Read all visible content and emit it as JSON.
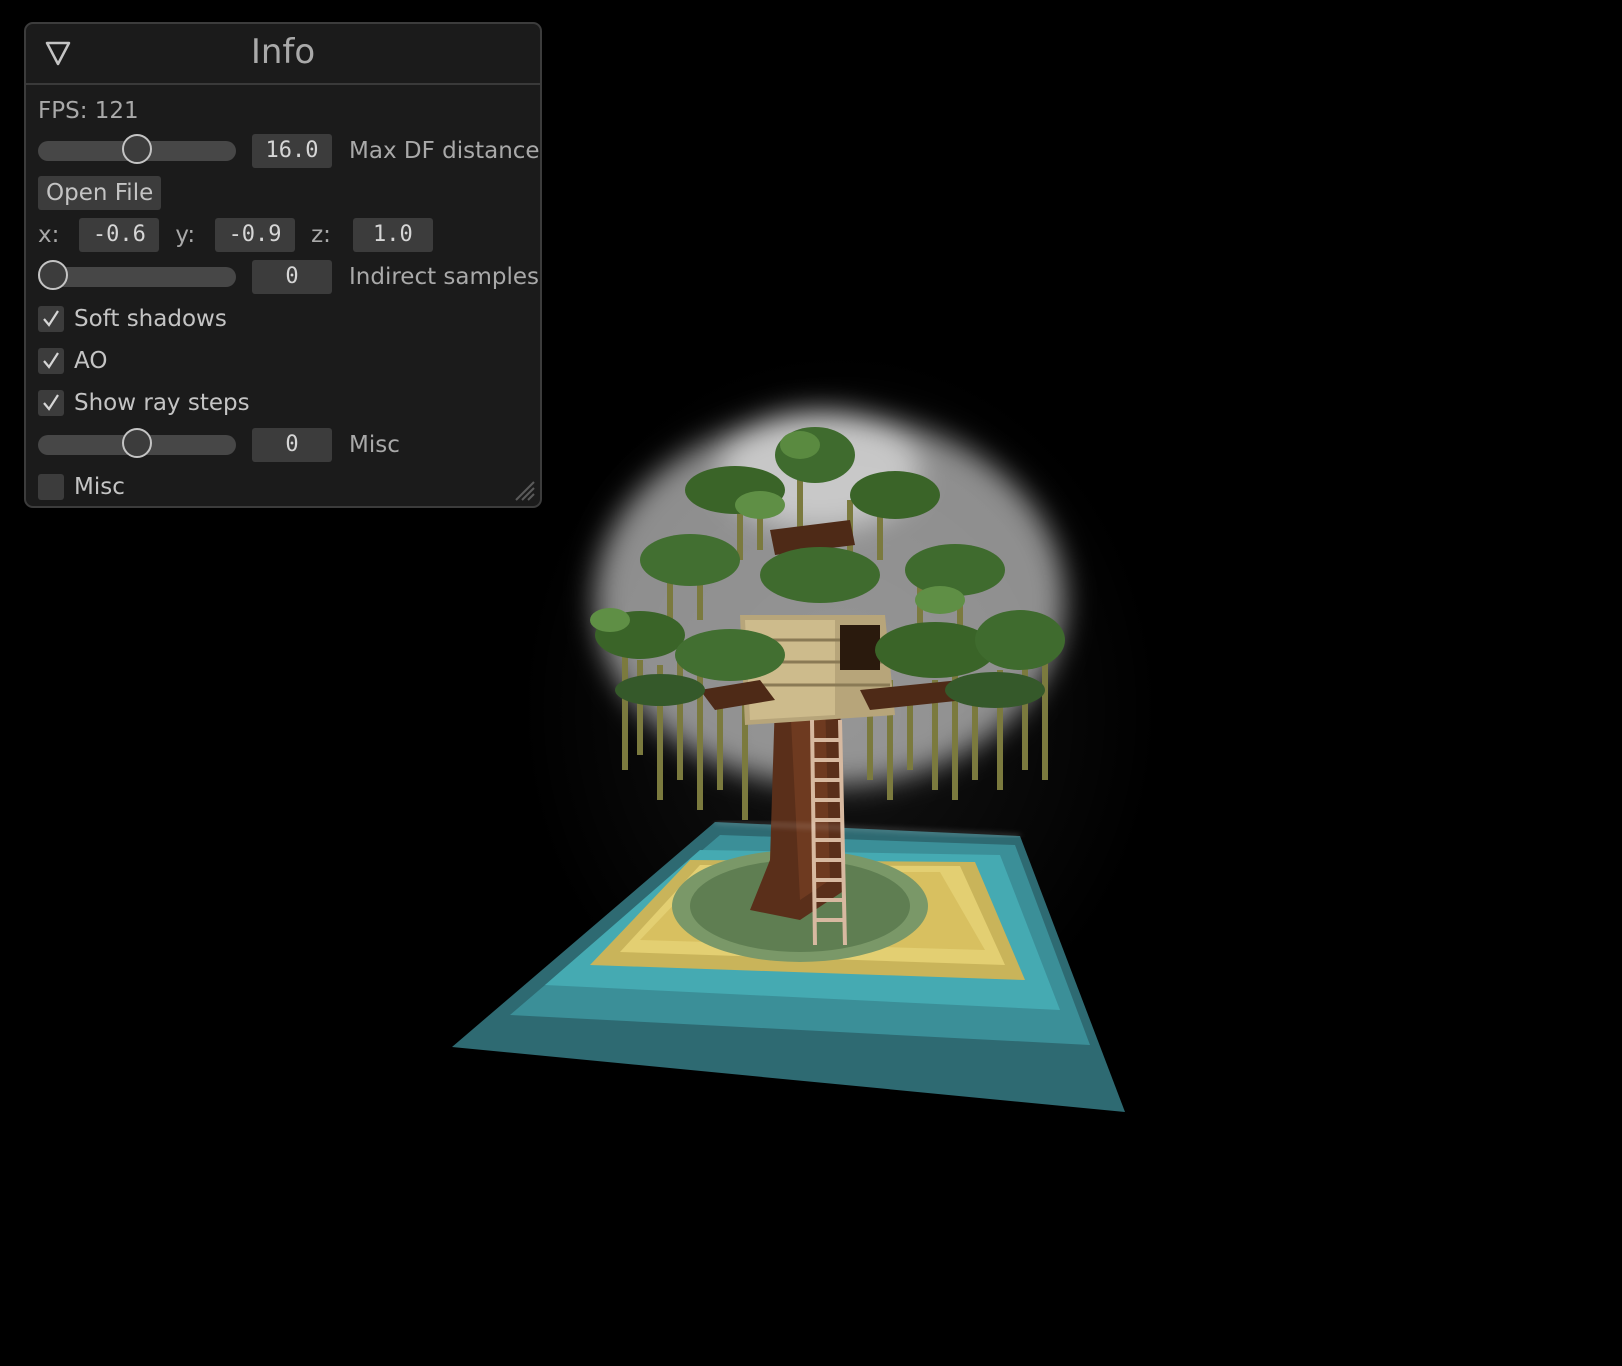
{
  "panel": {
    "title": "Info",
    "fps_text": "FPS: 121",
    "max_df": {
      "value_text": "16.0",
      "label": "Max DF distance",
      "slider_fraction": 0.5
    },
    "open_file_label": "Open File",
    "position": {
      "x_label": "x:",
      "x_value": "-0.6",
      "y_label": "y:",
      "y_value": "-0.9",
      "z_label": "z:",
      "z_value": "1.0"
    },
    "indirect": {
      "value_text": "0",
      "label": "Indirect samples",
      "slider_fraction": 0.0
    },
    "checkboxes": [
      {
        "label": "Soft shadows",
        "checked": true
      },
      {
        "label": "AO",
        "checked": true
      },
      {
        "label": "Show ray steps",
        "checked": true
      }
    ],
    "misc_slider": {
      "value_text": "0",
      "label": "Misc",
      "slider_fraction": 0.5
    },
    "misc_checkbox": {
      "label": "Misc",
      "checked": false
    }
  },
  "colors": {
    "panel_bg": "#1b1b1b",
    "widget_bg": "#3c3c3c",
    "text": "#a9a9a9",
    "water_dark": "#2e6a72",
    "water_light": "#3fa4ad",
    "sand": "#d9c46a",
    "grass": "#5f7e52",
    "trunk": "#5a2f1a",
    "leaves": "#3f6b2e",
    "glow": "#ffffff"
  }
}
